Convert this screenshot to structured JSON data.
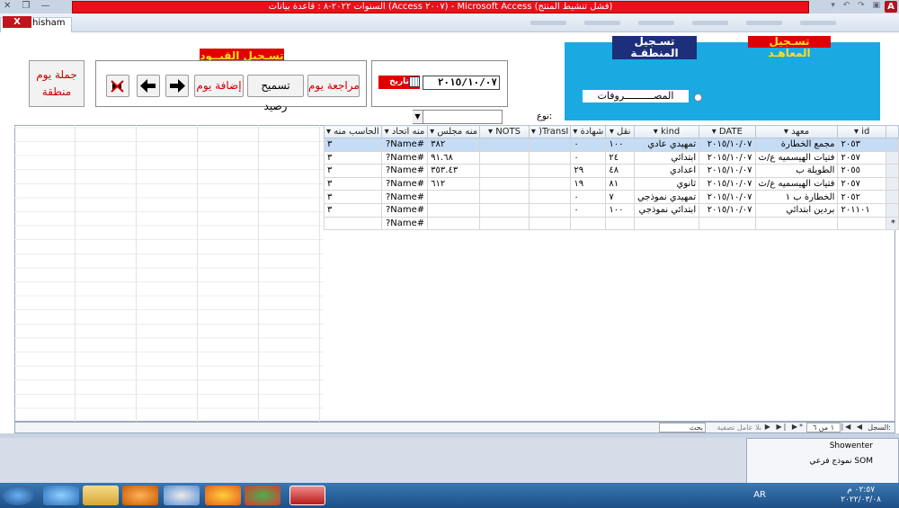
{
  "window": {
    "title": "السنوات ٢٠٢٢-٨ : قاعدة بيانات (Access ٢٠٠٧) - Microsoft Access (فشل تنشيط المنتج)",
    "logo": "A",
    "doc_tab": "hisham",
    "close_glyph": "X"
  },
  "form": {
    "day_summary_btn": [
      "جملة يوم",
      "منطقة"
    ],
    "restriction_title": "تسـجيل القيــود",
    "review_day_btn": "مراجعة يوم",
    "settle_balance_btn": "تسميح رصيد",
    "add_day_btn": "إضافة يوم",
    "date_label": "تاريخ اليوم",
    "date_value": "٢٠١٥/١٠/٠٧",
    "area_title": "تسـجيل المنطقـة",
    "institutes_title": "تسـجيل المعاهـد",
    "radio_label": "المصــــــــــروفات",
    "type_label": "نوع:",
    "type_value": ""
  },
  "table": {
    "columns": [
      "id",
      "معهد",
      "DATE",
      "kind",
      "نقل",
      "شهادة",
      "TransI(",
      "NOTS",
      "منه مجلس",
      "منه اتحاد",
      "الحاسب منه"
    ],
    "rows": [
      [
        "٢٠٥٣",
        "مجمع الخطارة",
        "٢٠١٥/١٠/٠٧",
        "تمهيدي عادي",
        "١٠٠",
        "٠",
        "",
        "",
        "٣٨٢",
        "#Name?",
        "٣"
      ],
      [
        "٢٠٥٧",
        "فتيات الهيسميه ع/ث",
        "٢٠١٥/١٠/٠٧",
        "ابتدائي",
        "٢٤",
        "٠",
        "",
        "",
        "٩١.٦٨",
        "#Name?",
        "٣"
      ],
      [
        "٢٠٥٥",
        "الطويلة ب",
        "٢٠١٥/١٠/٠٧",
        "اعدادي",
        "٤٨",
        "٢٩",
        "",
        "",
        "٣٥٣.٤٣",
        "#Name?",
        "٣"
      ],
      [
        "٢٠٥٧",
        "فتيات الهيسميه ع/ث",
        "٢٠١٥/١٠/٠٧",
        "ثانوي",
        "٨١",
        "١٩",
        "",
        "",
        "٦١٢",
        "#Name?",
        "٣"
      ],
      [
        "٢٠٥٢",
        "الخطارة ب ١",
        "٢٠١٥/١٠/٠٧",
        "تمهيدي نموذجي",
        "٧",
        "٠",
        "",
        "",
        "",
        "#Name?",
        "٣"
      ],
      [
        "٢٠١١٠١",
        "بردين ابتدائي",
        "٢٠١٥/١٠/٠٧",
        "ابتدائي نموذجي",
        "١٠٠",
        "٠",
        "",
        "",
        "",
        "#Name?",
        "٣"
      ],
      [
        "",
        "",
        "",
        "",
        "",
        "",
        "",
        "",
        "",
        "#Name?",
        ""
      ]
    ],
    "new_row_marker": "*"
  },
  "navigation": {
    "record_label": "السجل:",
    "record_position": "١ من ٦",
    "filter_label": "بلا عامل تصفية",
    "search_label": "بحث"
  },
  "popup": {
    "items": [
      "Showenter",
      "نموذج فرعي SOM"
    ]
  },
  "taskbar": {
    "lang": "AR",
    "time": "٠٢:٥٧ م",
    "date": "٢٠٢٢/٠٣/٠٨"
  }
}
